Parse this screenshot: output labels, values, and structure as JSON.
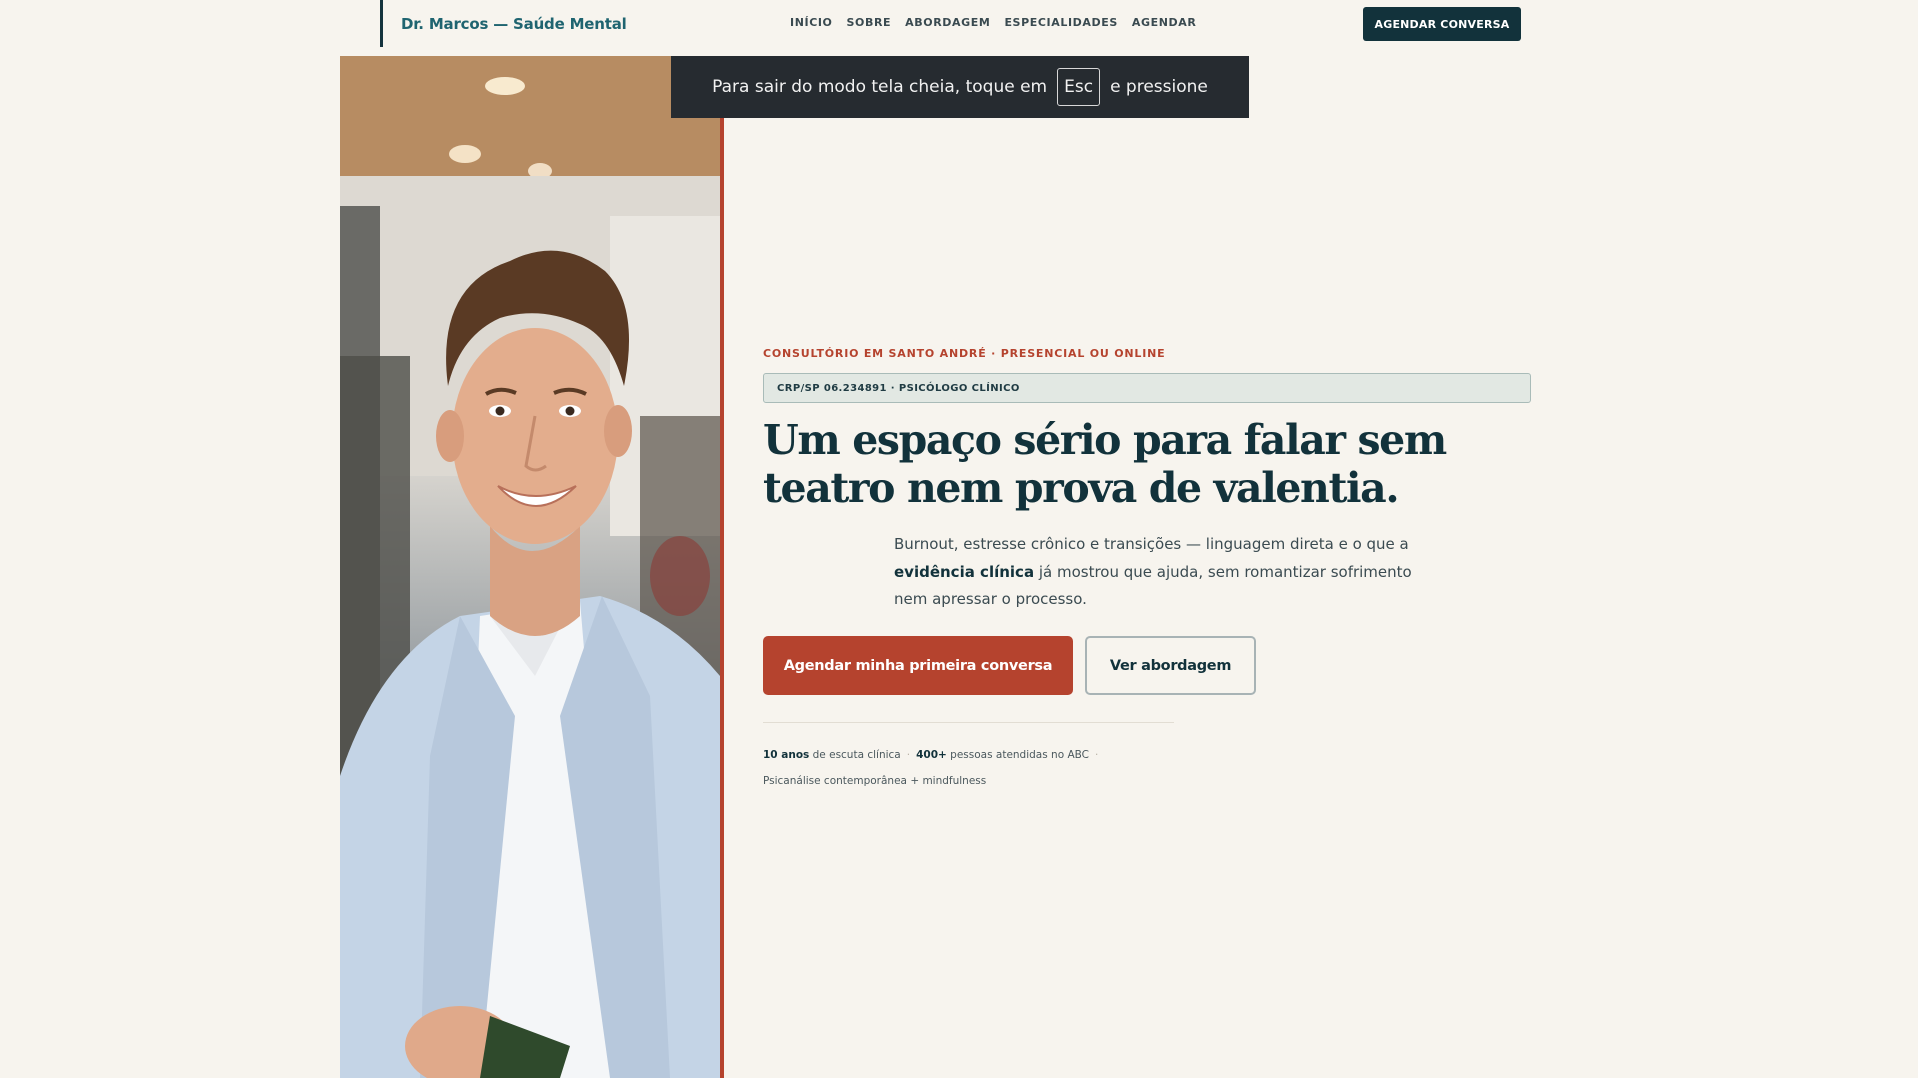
{
  "header": {
    "brand": "Dr. Marcos — Saúde Mental",
    "nav": [
      "INÍCIO",
      "SOBRE",
      "ABORDAGEM",
      "ESPECIALIDADES",
      "AGENDAR"
    ],
    "cta_label": "AGENDAR CONVERSA"
  },
  "fullscreen_toast": {
    "before": "Para sair do modo tela cheia, toque em",
    "key": "Esc",
    "after": "e pressione"
  },
  "hero": {
    "eyebrow": "CONSULTÓRIO EM SANTO ANDRÉ · PRESENCIAL OU ONLINE",
    "badge": "CRP/SP 06.234891 · PSICÓLOGO CLÍNICO",
    "headline": "Um espaço sério para falar sem teatro nem prova de valentia.",
    "lede_before": "Burnout, estresse crônico e transições — linguagem direta e o que a",
    "lede_strong": "evidência clínica",
    "lede_after": "já mostrou que ajuda, sem romantizar sofrimento nem apressar o processo.",
    "primary_button": "Agendar minha primeira conversa",
    "secondary_button": "Ver abordagem",
    "stats": [
      {
        "strong": "10 anos",
        "text": "de escuta clínica"
      },
      {
        "strong": "400+",
        "text": "pessoas atendidas no ABC"
      },
      {
        "strong": "",
        "text": "Psicanálise contemporânea + mindfulness"
      }
    ]
  },
  "colors": {
    "background": "#f7f4ee",
    "primary_dark": "#12323b",
    "accent": "#b5432e",
    "brand_teal": "#1f6470"
  },
  "photo": {
    "description_icon": "portrait-photo"
  }
}
